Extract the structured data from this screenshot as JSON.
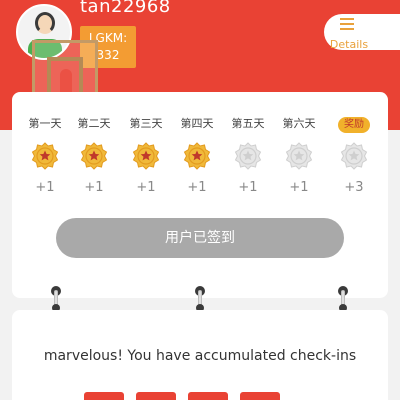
{
  "user": {
    "name": "tan22968",
    "lgkm_label": "LGKM:",
    "lgkm_value": "332"
  },
  "header": {
    "details_label": "Details",
    "details_icon": "list-icon"
  },
  "checkin": {
    "days": [
      {
        "label": "第一天",
        "reward": "+1",
        "checked": true
      },
      {
        "label": "第二天",
        "reward": "+1",
        "checked": true
      },
      {
        "label": "第三天",
        "reward": "+1",
        "checked": true
      },
      {
        "label": "第四天",
        "reward": "+1",
        "checked": true
      },
      {
        "label": "第五天",
        "reward": "+1",
        "checked": false
      },
      {
        "label": "第六天",
        "reward": "+1",
        "checked": false
      },
      {
        "label": "奖励",
        "reward": "+3",
        "checked": false
      }
    ],
    "button_label": "用户已签到"
  },
  "summary": {
    "message": "marvelous! You have accumulated check-ins"
  },
  "colors": {
    "primary": "#e94234",
    "accent": "#f39c33",
    "gold": "#e9a13b",
    "disabled": "#a9a9a9"
  }
}
